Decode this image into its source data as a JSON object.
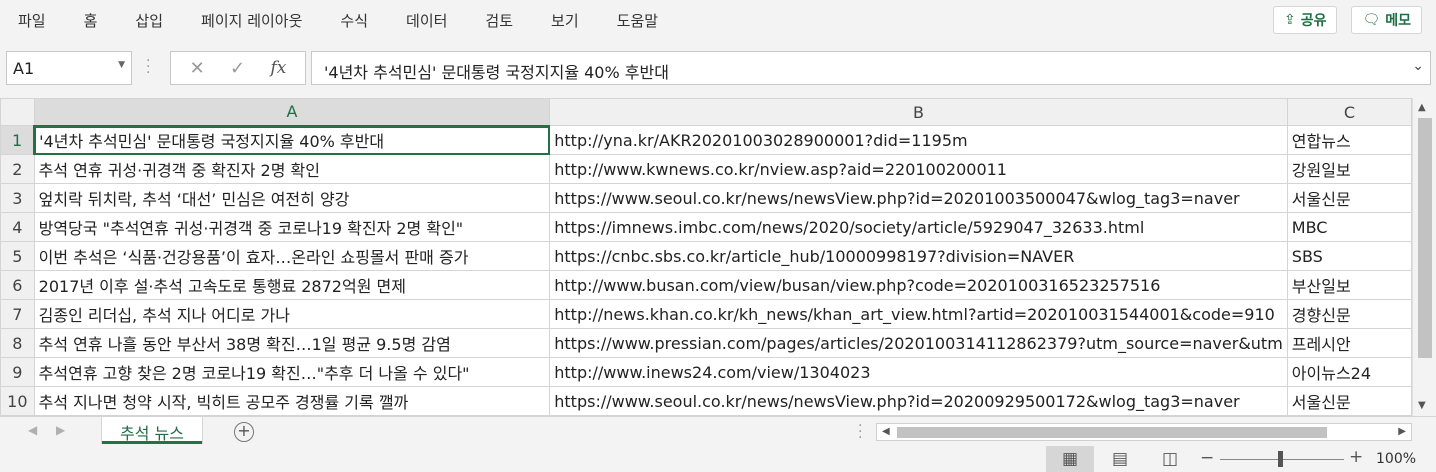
{
  "menu": [
    "파일",
    "홈",
    "삽입",
    "페이지 레이아웃",
    "수식",
    "데이터",
    "검토",
    "보기",
    "도움말"
  ],
  "share_label": "공유",
  "memo_label": "메모",
  "formula_bar": {
    "name_box": "A1",
    "formula": "'4년차 추석민심' 문대통령 국정지지율 40% 후반대",
    "fx": "fx"
  },
  "grid": {
    "columns": [
      "A",
      "B",
      "C"
    ],
    "selected_cell": "A1",
    "rows": [
      {
        "num": "1",
        "a": "'4년차 추석민심' 문대통령 국정지지율 40% 후반대",
        "b": "http://yna.kr/AKR20201003028900001?did=1195m",
        "c": "연합뉴스"
      },
      {
        "num": "2",
        "a": "추석 연휴 귀성·귀경객 중 확진자 2명 확인",
        "b": "http://www.kwnews.co.kr/nview.asp?aid=220100200011",
        "c": "강원일보"
      },
      {
        "num": "3",
        "a": "엎치락 뒤치락, 추석 ‘대선’ 민심은 여전히 양강",
        "b": "https://www.seoul.co.kr/news/newsView.php?id=20201003500047&wlog_tag3=naver",
        "c": "서울신문"
      },
      {
        "num": "4",
        "a": "방역당국 \"추석연휴 귀성·귀경객 중 코로나19 확진자 2명 확인\"",
        "b": "https://imnews.imbc.com/news/2020/society/article/5929047_32633.html",
        "c": "MBC"
      },
      {
        "num": "5",
        "a": "이번 추석은 ‘식품·건강용품’이 효자…온라인 쇼핑몰서 판매 증가",
        "b": "https://cnbc.sbs.co.kr/article_hub/10000998197?division=NAVER",
        "c": "SBS"
      },
      {
        "num": "6",
        "a": "2017년 이후 설·추석 고속도로 통행료 2872억원 면제",
        "b": "http://www.busan.com/view/busan/view.php?code=2020100316523257516",
        "c": "부산일보"
      },
      {
        "num": "7",
        "a": "김종인 리더십, 추석 지나 어디로 가나",
        "b": "http://news.khan.co.kr/kh_news/khan_art_view.html?artid=202010031544001&code=910",
        "c": "경향신문"
      },
      {
        "num": "8",
        "a": "추석 연휴 나흘 동안 부산서 38명 확진…1일 평균 9.5명 감염",
        "b": "https://www.pressian.com/pages/articles/2020100314112862379?utm_source=naver&utm",
        "c": "프레시안"
      },
      {
        "num": "9",
        "a": "추석연휴 고향 찾은 2명 코로나19 확진…\"추후 더 나올 수 있다\"",
        "b": "http://www.inews24.com/view/1304023",
        "c": "아이뉴스24"
      },
      {
        "num": "10",
        "a": "추석 지나면 청약 시작, 빅히트 공모주 경쟁률 기록 깰까",
        "b": "https://www.seoul.co.kr/news/newsView.php?id=20200929500172&wlog_tag3=naver",
        "c": "서울신문"
      }
    ]
  },
  "sheet_tab": "추석 뉴스",
  "status": {
    "zoom": "100%",
    "view_modes": [
      "normal-view-icon",
      "page-layout-icon",
      "page-break-icon"
    ]
  },
  "colors": {
    "accent": "#217346",
    "ribbon_bg": "#f3f3f3",
    "header_bg": "#f0f0f0"
  }
}
